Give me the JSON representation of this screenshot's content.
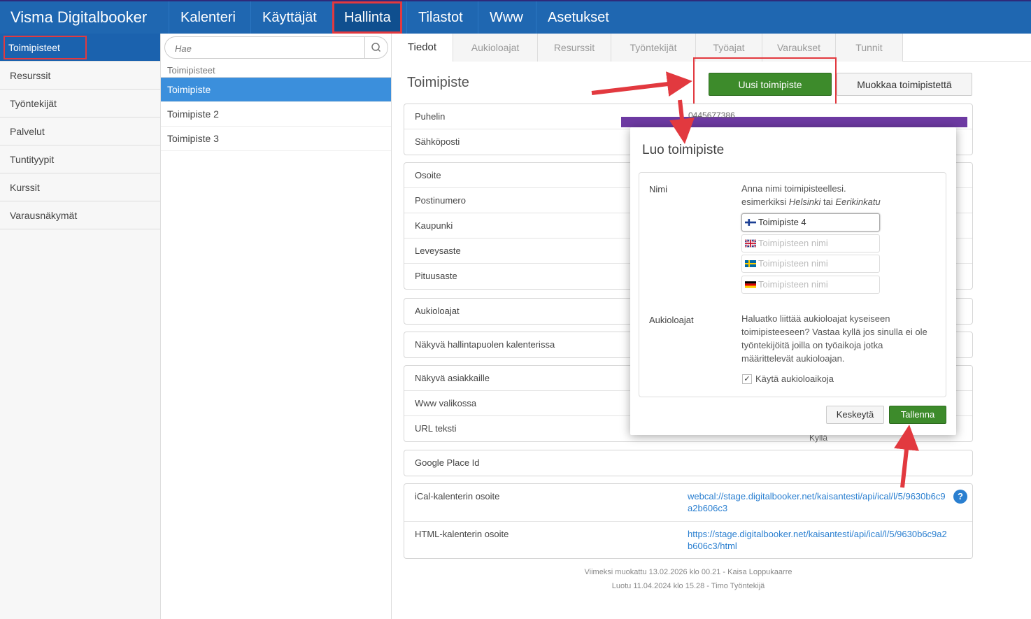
{
  "app": {
    "brand": "Visma Digitalbooker",
    "nav": [
      "Kalenteri",
      "Käyttäjät",
      "Hallinta",
      "Tilastot",
      "Www",
      "Asetukset"
    ]
  },
  "sidebar": {
    "items": [
      "Toimipisteet",
      "Resurssit",
      "Työntekijät",
      "Palvelut",
      "Tuntityypit",
      "Kurssit",
      "Varausnäkymät"
    ]
  },
  "list": {
    "search_placeholder": "Hae",
    "heading": "Toimipisteet",
    "items": [
      "Toimipiste",
      "Toimipiste 2",
      "Toimipiste 3"
    ]
  },
  "tabs": [
    "Tiedot",
    "Aukioloajat",
    "Resurssit",
    "Työntekijät",
    "Työajat",
    "Varaukset",
    "Tunnit"
  ],
  "detail": {
    "title": "Toimipiste",
    "new_button": "Uusi toimipiste",
    "edit_button": "Muokkaa toimipistettä",
    "groups": [
      [
        "Puhelin",
        "Sähköposti"
      ],
      [
        "Osoite",
        "Postinumero",
        "Kaupunki",
        "Leveysaste",
        "Pituusaste"
      ],
      [
        "Aukioloajat"
      ],
      [
        "Näkyvä hallintapuolen kalenterissa"
      ],
      [
        "Näkyvä asiakkaille",
        "Www valikossa",
        "URL teksti"
      ],
      [
        "Google Place Id"
      ]
    ],
    "ical_label": "iCal-kalenterin osoite",
    "ical_url": "webcal://stage.digitalbooker.net/kaisantesti/api/ical/l/5/9630b6c9a2b606c3",
    "html_label": "HTML-kalenterin osoite",
    "html_url": "https://stage.digitalbooker.net/kaisantesti/api/ical/l/5/9630b6c9a2b606c3/html",
    "help": "?",
    "phone_partial": "0445677386",
    "kylla": "Kyllä",
    "modified": "Viimeksi muokattu 13.02.2026 klo 00.21 - Kaisa Loppukaarre",
    "created": "Luotu 11.04.2024 klo 15.28 - Timo Työntekijä"
  },
  "modal": {
    "title": "Luo toimipiste",
    "name_label": "Nimi",
    "name_help_1": "Anna nimi toimipisteellesi.",
    "name_help_2a": "esimerkiksi ",
    "name_help_2b": "Helsinki",
    "name_help_2c": " tai ",
    "name_help_2d": "Eerikinkatu",
    "name_fi_value": "Toimipiste 4",
    "name_placeholder": "Toimipisteen nimi",
    "hours_label": "Aukioloajat",
    "hours_help": "Haluatko liittää aukioloajat kyseiseen toimipisteeseen? Vastaa kyllä jos sinulla ei ole työntekijöitä joilla on työaikoja jotka määrittelevät aukioloajan.",
    "hours_checkbox": "Käytä aukioloaikoja",
    "hours_checked": true,
    "cancel": "Keskeytä",
    "save": "Tallenna"
  },
  "colors": {
    "nav_bg": "#1f67b1",
    "accent_green": "#3d8b2b",
    "highlight_red": "#e2393f",
    "link_blue": "#2a7fd0"
  }
}
